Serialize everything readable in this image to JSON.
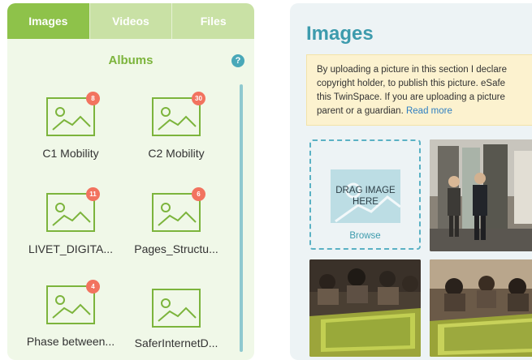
{
  "tabs": [
    {
      "label": "Images",
      "active": true
    },
    {
      "label": "Videos",
      "active": false
    },
    {
      "label": "Files",
      "active": false
    }
  ],
  "albums_header": "Albums",
  "help_icon": "?",
  "albums": [
    {
      "name": "C1 Mobility",
      "count": "8"
    },
    {
      "name": "C2 Mobility",
      "count": "30"
    },
    {
      "name": "LIVET_DIGITA...",
      "count": "11"
    },
    {
      "name": "Pages_Structu...",
      "count": "6"
    },
    {
      "name": "Phase between...",
      "count": "4"
    },
    {
      "name": "SaferInternetD...",
      "count": ""
    }
  ],
  "images_title": "Images",
  "notice": {
    "line1": "By uploading a picture in this section I declare",
    "line2": "copyright holder, to publish this picture. eSafe",
    "line3": "this TwinSpace. If you are uploading a picture",
    "line4_prefix": "parent or a guardian.",
    "read_more": "Read more"
  },
  "drop_zone": {
    "text": "DRAG IMAGE HERE",
    "browse": "Browse"
  },
  "colors": {
    "tab_active": "#8ec24a",
    "tab_inactive": "#c9e1a5",
    "album_green": "#7cb43c",
    "badge": "#f2735f",
    "title_teal": "#3d9bad",
    "notice_bg": "#fcf2cf"
  },
  "photos": [
    {
      "name": "photo-two-people-in-hallway"
    },
    {
      "name": "photo-students-at-table-1"
    },
    {
      "name": "photo-students-at-table-2"
    }
  ]
}
